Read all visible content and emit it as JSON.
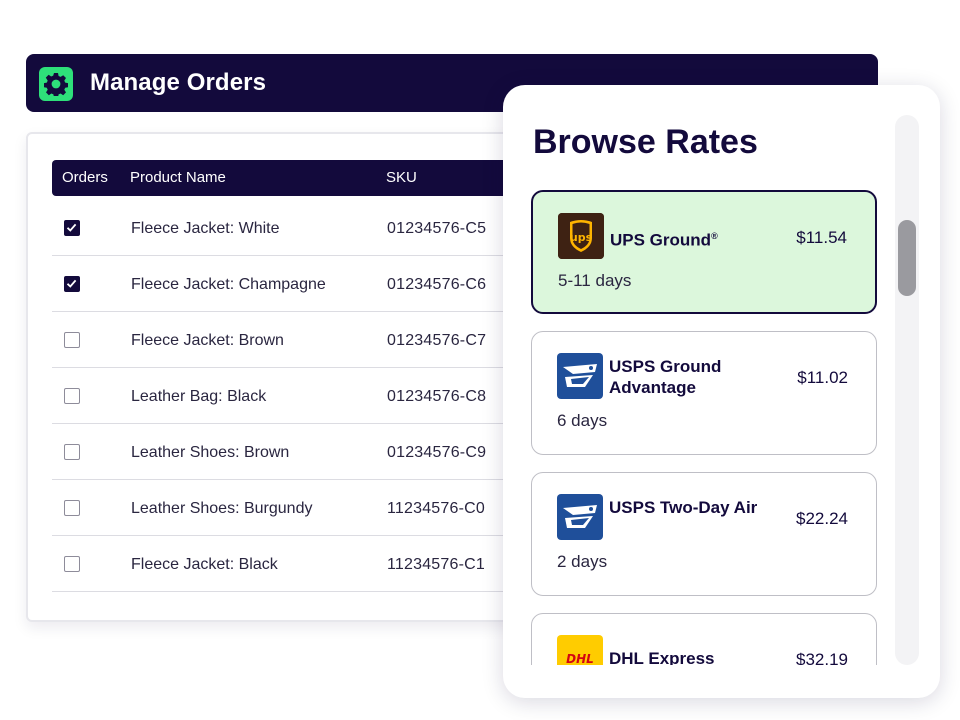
{
  "header": {
    "title": "Manage Orders",
    "icon": "gear-icon",
    "background": "#130a3c",
    "icon_color": "#2ee07a"
  },
  "orders_table": {
    "columns": [
      "Orders",
      "Product Name",
      "SKU"
    ],
    "rows": [
      {
        "checked": true,
        "product": "Fleece Jacket: White",
        "sku": "01234576-C5"
      },
      {
        "checked": true,
        "product": "Fleece Jacket: Champagne",
        "sku": "01234576-C6"
      },
      {
        "checked": false,
        "product": "Fleece Jacket: Brown",
        "sku": "01234576-C7"
      },
      {
        "checked": false,
        "product": "Leather Bag: Black",
        "sku": "01234576-C8"
      },
      {
        "checked": false,
        "product": "Leather Shoes: Brown",
        "sku": "01234576-C9"
      },
      {
        "checked": false,
        "product": "Leather Shoes: Burgundy",
        "sku": "11234576-C0"
      },
      {
        "checked": false,
        "product": "Fleece Jacket: Black",
        "sku": "11234576-C1"
      }
    ]
  },
  "rates": {
    "title": "Browse Rates",
    "items": [
      {
        "carrier": "UPS Ground",
        "mark": "®",
        "price": "$11.54",
        "days": "5-11 days",
        "selected": true,
        "logo": "ups-logo-icon",
        "logo_text": "ups"
      },
      {
        "carrier": "USPS Ground Advantage",
        "price": "$11.02",
        "days": "6 days",
        "selected": false,
        "logo": "usps-eagle-icon"
      },
      {
        "carrier": "USPS Two-Day Air",
        "price": "$22.24",
        "days": "2 days",
        "selected": false,
        "logo": "usps-eagle-icon"
      },
      {
        "carrier": "DHL Express",
        "price": "$32.19",
        "days": "",
        "selected": false,
        "logo": "dhl-logo-icon",
        "logo_text": "DHL"
      }
    ],
    "selected_color": "#dcf7dc"
  }
}
